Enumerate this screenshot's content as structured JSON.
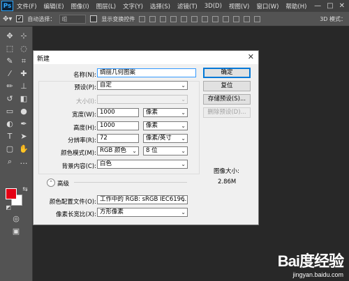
{
  "app": {
    "logo": "Ps"
  },
  "menubar": {
    "items": [
      "文件(F)",
      "编辑(E)",
      "图像(I)",
      "图层(L)",
      "文字(Y)",
      "选择(S)",
      "滤镜(T)",
      "3D(D)",
      "视图(V)",
      "窗口(W)",
      "帮助(H)"
    ],
    "window_controls": [
      "—",
      "□",
      "✕"
    ]
  },
  "options_bar": {
    "auto_select_label": "自动选择：",
    "auto_select_value": "组",
    "show_transform_label": "显示变换控件",
    "mode_3d_label": "3D 模式："
  },
  "dialog": {
    "title": "新建",
    "close_glyph": "✕",
    "name_label": "名称(N):",
    "name_value": "绸丽几何图案",
    "preset_label": "预设(P):",
    "preset_value": "自定",
    "size_label": "大小(I):",
    "size_value": "",
    "width_label": "宽度(W):",
    "width_value": "1000",
    "width_unit": "像素",
    "height_label": "高度(H):",
    "height_value": "1000",
    "height_unit": "像素",
    "resolution_label": "分辨率(R):",
    "resolution_value": "72",
    "resolution_unit": "像素/英寸",
    "color_mode_label": "颜色模式(M):",
    "color_mode_value": "RGB 颜色",
    "bit_depth_value": "8 位",
    "background_label": "背景内容(C):",
    "background_value": "白色",
    "advanced_label": "高级",
    "color_profile_label": "颜色配置文件(O):",
    "color_profile_value": "工作中的 RGB: sRGB IEC6196...",
    "pixel_aspect_label": "像素长宽比(X):",
    "pixel_aspect_value": "方形像素",
    "ok_label": "确定",
    "reset_label": "复位",
    "save_preset_label": "存储预设(S)...",
    "delete_preset_label": "删除预设(D)...",
    "image_size_label": "图像大小:",
    "image_size_value": "2.86M"
  },
  "watermark": {
    "logo": "Bai度经验",
    "url": "jingyan.baidu.com"
  },
  "colors": {
    "foreground": "#e50014",
    "background": "#ffffff",
    "accent": "#0078d7"
  }
}
